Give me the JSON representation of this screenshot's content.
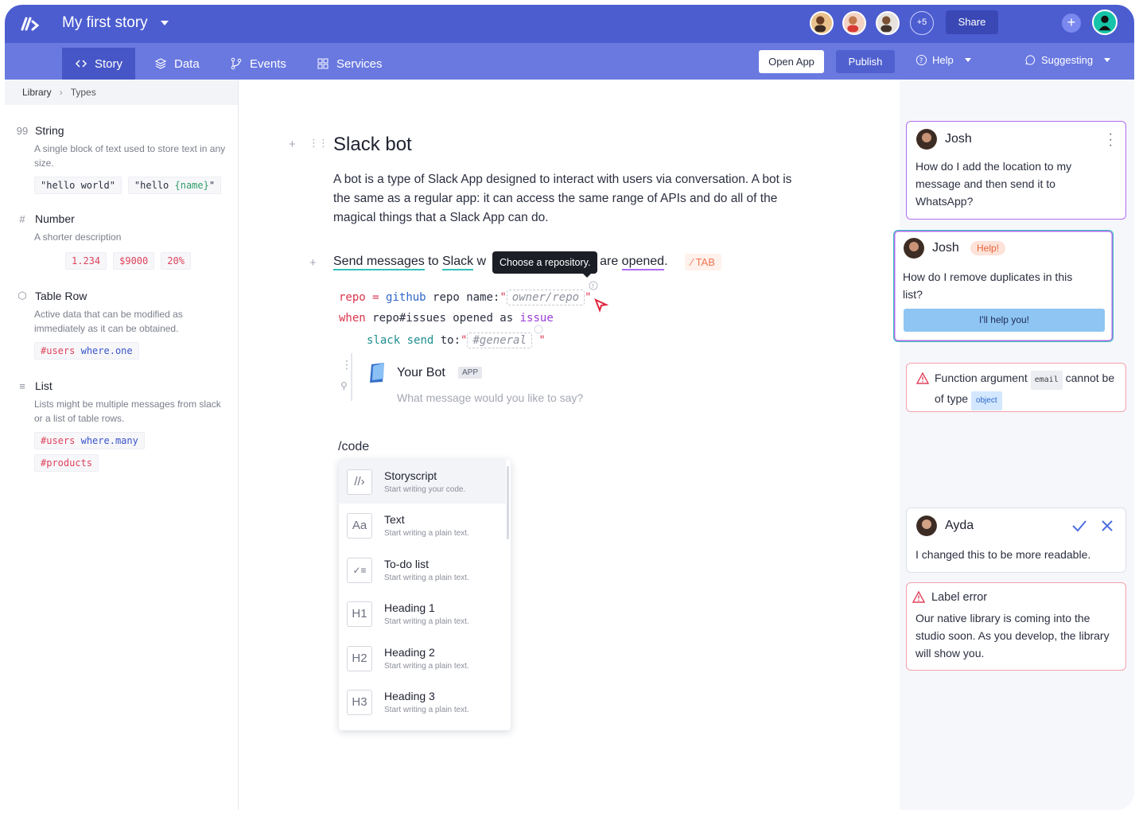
{
  "app": {
    "story_title": "My first story",
    "more_collaborators": "+5",
    "share_label": "Share",
    "add_symbol": "+"
  },
  "nav": {
    "tabs": [
      {
        "label": "Story",
        "icon": "code-brackets-icon",
        "active": true
      },
      {
        "label": "Data",
        "icon": "layers-icon"
      },
      {
        "label": "Events",
        "icon": "branch-icon"
      },
      {
        "label": "Services",
        "icon": "grid-icon"
      }
    ],
    "open_app": "Open App",
    "publish": "Publish",
    "help": "Help",
    "suggesting": "Suggesting"
  },
  "sidebar": {
    "breadcrumb": [
      "Library",
      "Types"
    ],
    "types": [
      {
        "name": "String",
        "icon": "quote-icon",
        "description": "A single block of text used to store text in any size."
      },
      {
        "name": "Number",
        "icon": "hash-icon",
        "description": "A shorter description",
        "chips": [
          "1.234",
          "$9000",
          "20%"
        ]
      },
      {
        "name": "Table Row",
        "icon": "cube-icon",
        "description": "Active data that can be modified as immediately as it can be obtained."
      },
      {
        "name": "List",
        "icon": "list-icon",
        "description": "Lists might be multiple messages from slack or a list of table rows."
      }
    ],
    "string_chips": {
      "hello_world": "\"hello world\"",
      "hello_open": "\"hello ",
      "name_var": "{name}",
      "hello_close": "\""
    },
    "row_chip": {
      "prefix": "#users",
      "kw": "where.one"
    },
    "list_chips": {
      "prefix": "#users",
      "kw": "where.many",
      "products": "#products"
    }
  },
  "main": {
    "heading": "Slack bot",
    "paragraph": "A bot is a type of Slack App designed to interact with users via conversation. A bot is the same as a regular app: it can access the same range of APIs and do all of the magical things that a Slack App can do.",
    "sentence": {
      "part1": "Send messages",
      "part2": " to ",
      "part3": "Slack",
      "part4": " w",
      "part5": "are ",
      "part6": "opened",
      "part7": "."
    },
    "tooltip": "Choose a repository.",
    "tab_badge": "TAB",
    "code": {
      "l1_var": "repo",
      "l1_eq": "=",
      "l1_service": "github",
      "l1_rest": "repo name:",
      "l1_quote": "\"",
      "l1_placeholder": "owner/repo",
      "l2_kw": "when",
      "l2_rest": "repo#issues opened as",
      "l2_var": "issue",
      "l3_service": "slack",
      "l3_cmd": "send",
      "l3_rest": "to:",
      "l3_placeholder": "#general"
    },
    "bot": {
      "name": "Your Bot",
      "badge": "APP",
      "placeholder": "What message would you like to say?"
    },
    "slash_command": "/code",
    "menu": [
      {
        "title": "Storyscript",
        "subtitle": "Start writing your code.",
        "icon": "storyscript-icon",
        "glyph": "//›"
      },
      {
        "title": "Text",
        "subtitle": "Start writing a plain text.",
        "icon": "text-icon",
        "glyph": "Aa"
      },
      {
        "title": "To-do list",
        "subtitle": "Start writing a plain text.",
        "icon": "todo-icon",
        "glyph": "✓≡"
      },
      {
        "title": "Heading 1",
        "subtitle": "Start writing a plain text.",
        "icon": "heading1-icon",
        "glyph": "H1"
      },
      {
        "title": "Heading 2",
        "subtitle": "Start writing a plain text.",
        "icon": "heading2-icon",
        "glyph": "H2"
      },
      {
        "title": "Heading 3",
        "subtitle": "Start writing a plain text.",
        "icon": "heading3-icon",
        "glyph": "H3"
      }
    ]
  },
  "comments": [
    {
      "author": "Josh",
      "text": "How do I add the location to my message and then send it to WhatsApp?",
      "accent": "#b06cf0"
    },
    {
      "author": "Josh",
      "tag": "Help!",
      "text": "How do I remove duplicates in this list?",
      "button": "I'll help you!",
      "accent": "#35c3b8"
    },
    {
      "kind": "error",
      "text_a": "Function argument",
      "code": "email",
      "text_b": "cannot be of type",
      "type": "object",
      "accent": "#f3a0ac"
    },
    {
      "author": "Ayda",
      "text": "I changed this to be more readable.",
      "accent": "#dcdfe8"
    },
    {
      "kind": "error",
      "title": "Label error",
      "text": "Our native library is coming into the studio soon. As you develop, the library will show you.",
      "accent": "#f3a0ac"
    }
  ],
  "colors": {
    "topbar": "#4c5dd0",
    "navbar": "#6a79e0",
    "error": "#e0425b",
    "teal": "#35c3b8",
    "purple": "#b06cf0"
  }
}
